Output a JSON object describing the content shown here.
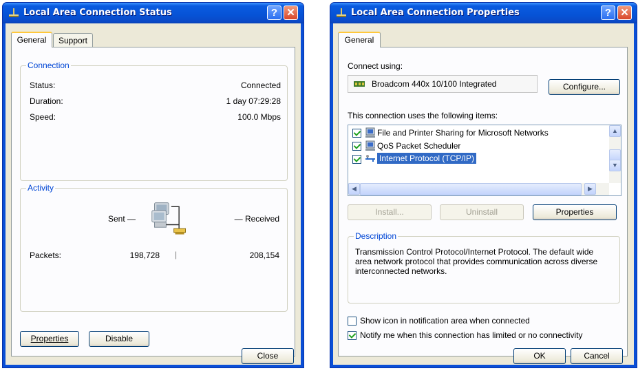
{
  "status_window": {
    "title": "Local Area Connection Status",
    "tabs": [
      "General",
      "Support"
    ],
    "connection": {
      "legend": "Connection",
      "status_label": "Status:",
      "status_value": "Connected",
      "duration_label": "Duration:",
      "duration_value": "1 day 07:29:28",
      "speed_label": "Speed:",
      "speed_value": "100.0 Mbps"
    },
    "activity": {
      "legend": "Activity",
      "sent_label": "Sent —",
      "received_label": "— Received",
      "packets_label": "Packets:",
      "packets_sent": "198,728",
      "packets_received": "208,154",
      "divider": "|"
    },
    "buttons": {
      "properties": "Properties",
      "disable": "Disable",
      "close": "Close"
    }
  },
  "properties_window": {
    "title": "Local Area Connection Properties",
    "tabs": [
      "General"
    ],
    "connect_using_label": "Connect using:",
    "adapter_name": "Broadcom 440x 10/100 Integrated",
    "configure_button": "Configure...",
    "items_label": "This connection uses the following items:",
    "items": [
      {
        "label": "File and Printer Sharing for Microsoft Networks",
        "checked": true,
        "selected": false,
        "icon": "network-service-icon"
      },
      {
        "label": "QoS Packet Scheduler",
        "checked": true,
        "selected": false,
        "icon": "network-service-icon"
      },
      {
        "label": "Internet Protocol (TCP/IP)",
        "checked": true,
        "selected": true,
        "icon": "protocol-icon"
      }
    ],
    "buttons": {
      "install": "Install...",
      "uninstall": "Uninstall",
      "properties": "Properties",
      "ok": "OK",
      "cancel": "Cancel"
    },
    "description": {
      "legend": "Description",
      "text": "Transmission Control Protocol/Internet Protocol. The default wide area network protocol that provides communication across diverse interconnected networks."
    },
    "show_icon_label": "Show icon in notification area when connected",
    "show_icon_checked": false,
    "notify_label": "Notify me when this connection has limited or no connectivity",
    "notify_checked": true
  },
  "title_buttons": {
    "help": "?",
    "close": "✕"
  },
  "colors": {
    "titlebar": "#0a5be0",
    "dialog": "#ece9d8",
    "group_legend": "#0046d5",
    "selection": "#316ac5"
  }
}
